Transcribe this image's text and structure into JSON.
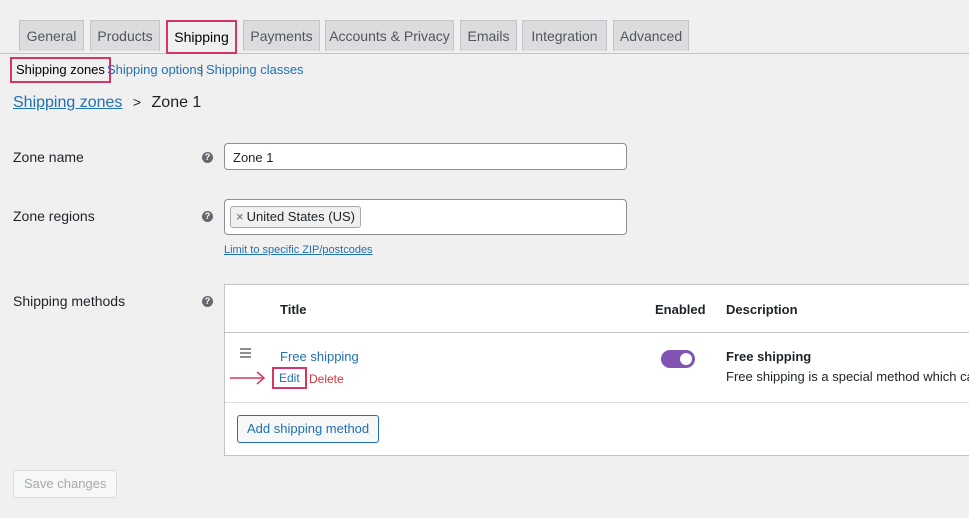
{
  "tabs": [
    "General",
    "Products",
    "Shipping",
    "Payments",
    "Accounts & Privacy",
    "Emails",
    "Integration",
    "Advanced"
  ],
  "active_tab": "Shipping",
  "subnav": {
    "current": "Shipping zones",
    "options": "Shipping options",
    "separator": "|",
    "classes": "Shipping classes"
  },
  "breadcrumb": {
    "parent": "Shipping zones",
    "separator": ">",
    "current": "Zone 1"
  },
  "zone_name": {
    "label": "Zone name",
    "value": "Zone 1"
  },
  "zone_regions": {
    "label": "Zone regions",
    "chip_remove": "×",
    "chip": "United States (US)",
    "limit_link": "Limit to specific ZIP/postcodes"
  },
  "shipping_methods": {
    "label": "Shipping methods",
    "columns": {
      "title": "Title",
      "enabled": "Enabled",
      "description": "Description"
    },
    "rows": [
      {
        "title": "Free shipping",
        "enabled": true,
        "edit": "Edit",
        "delete": "Delete",
        "description_title": "Free shipping",
        "description_text": "Free shipping is a special method which can"
      }
    ],
    "add_button": "Add shipping method"
  },
  "help_glyph": "?",
  "save_button": "Save changes",
  "colors": {
    "highlight": "#d63665",
    "link": "#2271b1",
    "toggle_on": "#7f54b3",
    "delete": "#d63638"
  }
}
